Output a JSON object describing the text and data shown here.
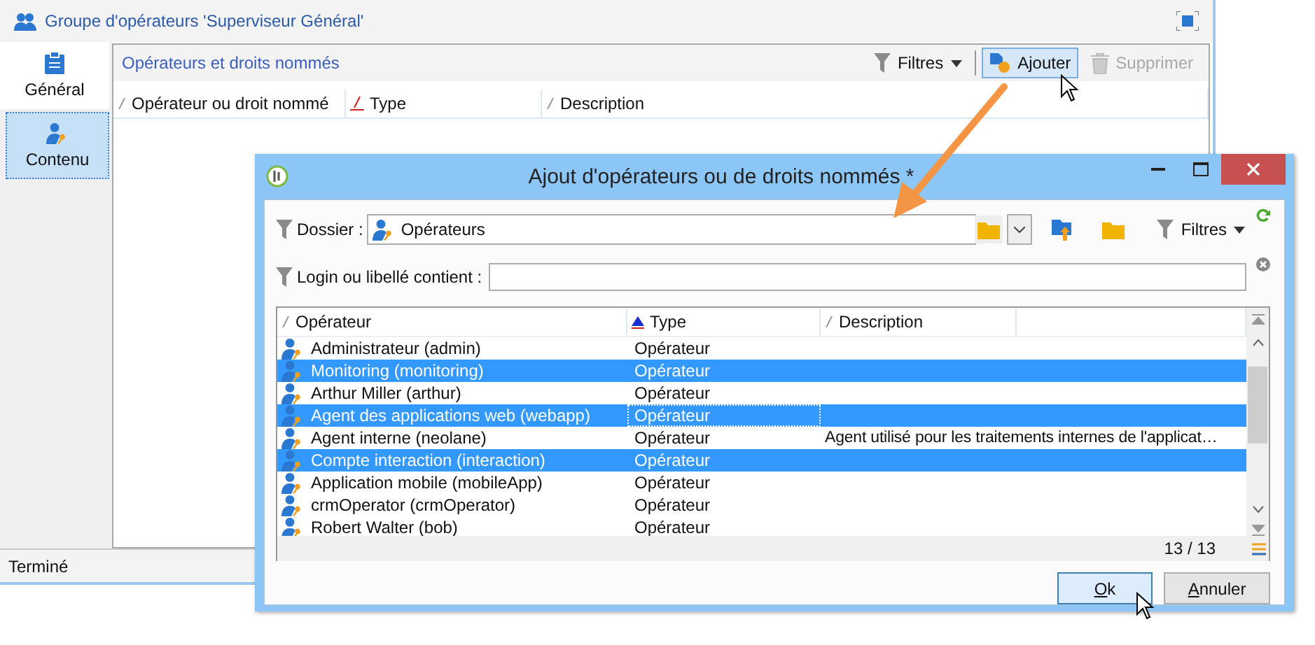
{
  "main_window": {
    "title": "Groupe d'opérateurs 'Superviseur Général'",
    "sidebar": {
      "items": [
        {
          "label": "Général",
          "kind": "clipboard",
          "selected": false
        },
        {
          "label": "Contenu",
          "kind": "operator",
          "selected": true
        }
      ]
    },
    "panel": {
      "title": "Opérateurs et droits nommés",
      "toolbar": [
        {
          "label": "Filtres",
          "kind": "filter",
          "highlighted": false,
          "disabled": false
        },
        {
          "label": "Ajouter",
          "kind": "add",
          "highlighted": true,
          "disabled": false
        },
        {
          "label": "Supprimer",
          "kind": "delete",
          "highlighted": false,
          "disabled": true
        }
      ],
      "columns": [
        {
          "label": "Opérateur ou droit nommé",
          "sorted": false
        },
        {
          "label": "Type",
          "sorted": true
        },
        {
          "label": "Description",
          "sorted": false
        }
      ]
    },
    "status_bar": "Terminé"
  },
  "dialog": {
    "title": "Ajout d'opérateurs ou de droits nommés *",
    "folder": {
      "label": "Dossier :",
      "value": "Opérateurs"
    },
    "filters_label": "Filtres",
    "search": {
      "label": "Login ou libellé contient :"
    },
    "columns": [
      {
        "label": "Opérateur",
        "sorted": false
      },
      {
        "label": "Type",
        "sorted": true
      },
      {
        "label": "Description",
        "sorted": false
      }
    ],
    "rows": [
      {
        "name": "Administrateur (admin)",
        "type": "Opérateur",
        "selected": false,
        "focused": false
      },
      {
        "name": "Monitoring (monitoring)",
        "type": "Opérateur",
        "selected": true,
        "focused": false
      },
      {
        "name": "Arthur Miller (arthur)",
        "type": "Opérateur",
        "selected": false,
        "focused": false
      },
      {
        "name": "Agent des applications web (webapp)",
        "type": "Opérateur",
        "selected": true,
        "focused": true
      },
      {
        "name": "Agent interne (neolane)",
        "type": "Opérateur",
        "description": "Agent utilisé pour les traitements internes de l'applicat…",
        "selected": false,
        "focused": false
      },
      {
        "name": "Compte interaction (interaction)",
        "type": "Opérateur",
        "selected": true,
        "focused": false
      },
      {
        "name": "Application mobile (mobileApp)",
        "type": "Opérateur",
        "selected": false,
        "focused": false
      },
      {
        "name": "crmOperator (crmOperator)",
        "type": "Opérateur",
        "selected": false,
        "focused": false
      },
      {
        "name": "Robert Walter (bob)",
        "type": "Opérateur",
        "selected": false,
        "focused": false
      }
    ],
    "count": "13 / 13",
    "buttons": [
      {
        "label": "Ok",
        "default": true
      },
      {
        "label": "Annuler",
        "default": false
      }
    ]
  }
}
